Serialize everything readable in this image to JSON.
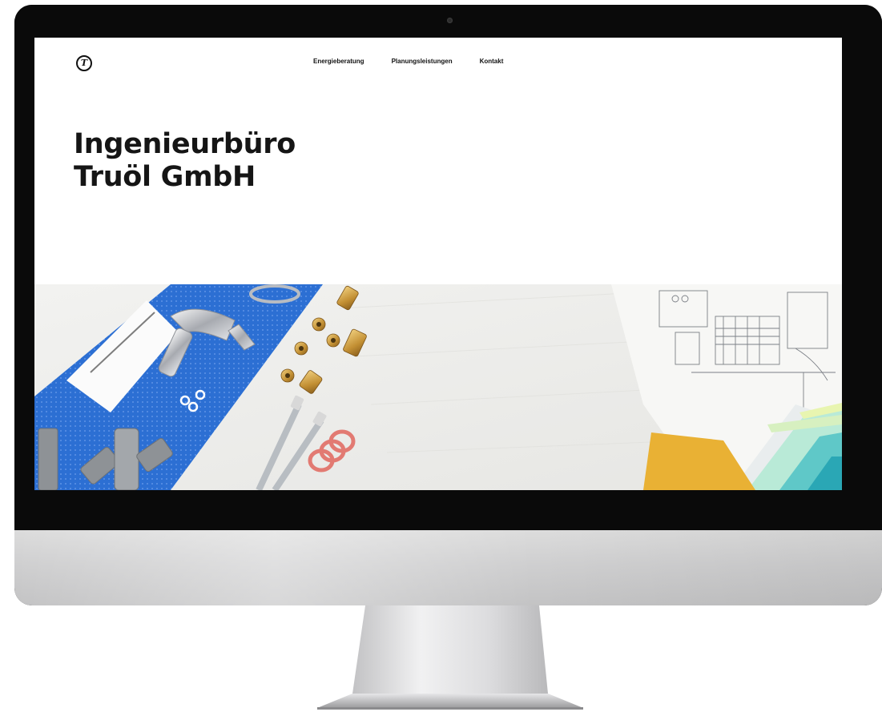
{
  "site": {
    "logo": {
      "icon": "logo-t-circle-icon",
      "glyph": "T"
    },
    "nav": [
      {
        "label": "Energieberatung"
      },
      {
        "label": "Planungsleistungen"
      },
      {
        "label": "Kontakt"
      }
    ],
    "hero": {
      "title_line1": "Ingenieurbüro",
      "title_line2": "Truöl GmbH"
    },
    "hero_image": {
      "subject": "plumbing-tools-and-floor-plan-photo"
    }
  },
  "colors": {
    "text": "#151515",
    "mat_blue": "#2c6fd3",
    "brass": "#c99a3a",
    "gasket": "#e27a72",
    "chin_silver": "#cfcfd0",
    "bezel": "#0a0a0a"
  }
}
